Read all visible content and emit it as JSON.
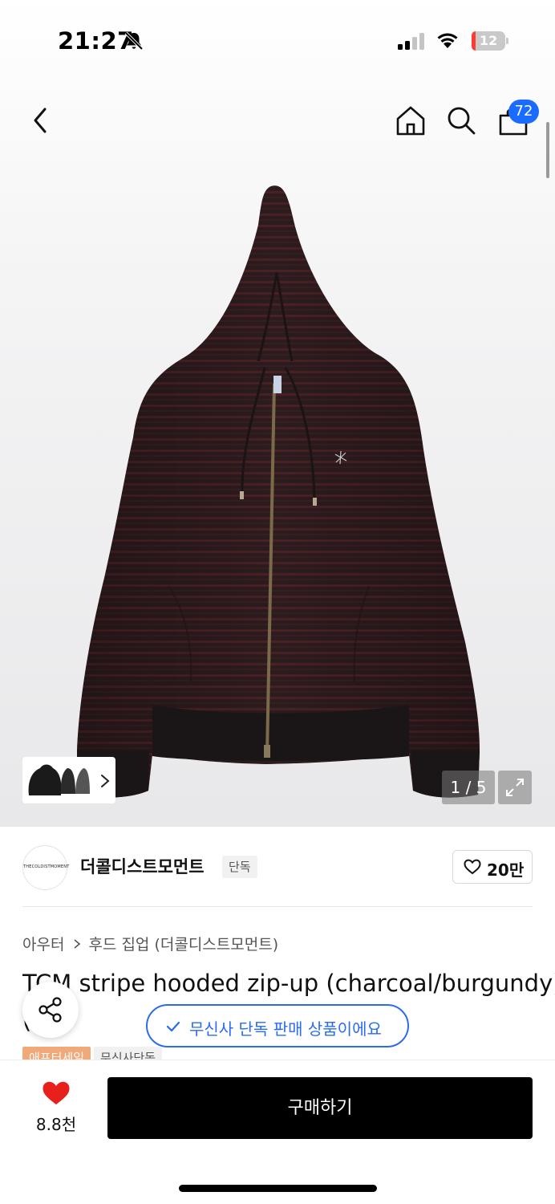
{
  "status_bar": {
    "time": "21:27",
    "battery_level": "12",
    "battery_fraction": 0.12,
    "battery_color": "#ff3b30"
  },
  "header": {
    "cart_count": "72",
    "badge_color": "#1a6bff"
  },
  "gallery": {
    "page_counter": "1 / 5",
    "current_page": 1,
    "total_pages": 5
  },
  "brand": {
    "logo_text": "THECOLDISTMOMENT",
    "name": "더콜디스트모먼트",
    "exclusive_tag": "단독",
    "like_count": "20만"
  },
  "product": {
    "breadcrumb": [
      "아우터",
      "후드 집업 (더콜디스트모먼트)"
    ],
    "title": "TCM stripe hooded zip-up (charcoal/burgundy)",
    "title_line2": "(",
    "tags": [
      "애프터세일",
      "무신사단독"
    ]
  },
  "floating": {
    "exclusive_notice": "무신사 단독 판매 상품이에요",
    "accent_color": "#2a6bf0"
  },
  "bottom_bar": {
    "wish_count": "8.8천",
    "buy_label": "구매하기"
  },
  "icons": {
    "back": "chevron-left-icon",
    "home": "home-icon",
    "search": "search-icon",
    "cart": "shopping-bag-icon",
    "share": "share-icon",
    "heart": "heart-icon",
    "expand": "expand-icon"
  }
}
